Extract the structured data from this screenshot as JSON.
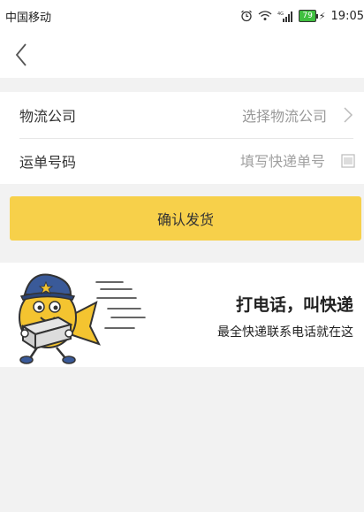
{
  "statusbar": {
    "carrier": "中国移动",
    "time": "19:05",
    "battery_level": "79"
  },
  "nav": {
    "back_icon": "chevron-left-icon"
  },
  "form": {
    "company_label": "物流公司",
    "company_value": "选择物流公司",
    "tracking_label": "运单号码",
    "tracking_placeholder": "填写快递单号"
  },
  "confirm_button": "确认发货",
  "banner": {
    "title": "打电话，叫快递",
    "subtitle": "最全快递联系电话就在这"
  },
  "colors": {
    "accent": "#f7d04a",
    "background": "#f2f2f2"
  }
}
